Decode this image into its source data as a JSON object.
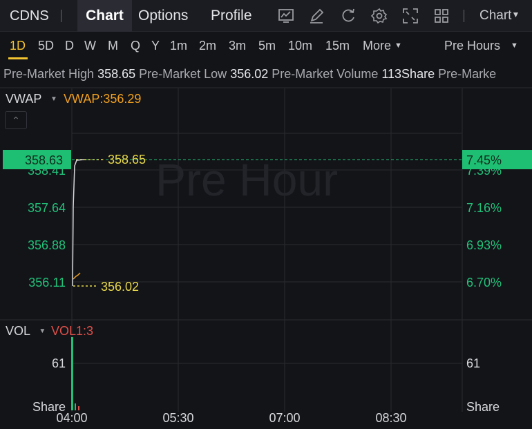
{
  "topbar": {
    "ticker": "CDNS",
    "tabs": [
      "Chart",
      "Options",
      "Profile"
    ],
    "active_tab": "Chart",
    "chart_menu": "Chart",
    "tools": [
      "chart-icon",
      "draw-pen-icon",
      "refresh-icon",
      "settings-gear-icon",
      "fullscreen-icon",
      "grid-layout-icon"
    ]
  },
  "timeframes": {
    "items": [
      "1D",
      "5D",
      "D",
      "W",
      "M",
      "Q",
      "Y",
      "1m",
      "2m",
      "3m",
      "5m",
      "10m",
      "15m",
      "More"
    ],
    "active": "1D",
    "session": "Pre Hours"
  },
  "info": {
    "high_label": "Pre-Market High",
    "high": "358.65",
    "low_label": "Pre-Market Low",
    "low": "356.02",
    "volume_label": "Pre-Market Volume",
    "volume": "113Share",
    "trailing": "Pre-Marke"
  },
  "indicators": {
    "main_name": "VWAP",
    "main_value": "VWAP:356.29",
    "sub_name": "VOL",
    "sub_value": "VOL1:3",
    "collapse_symbol": "⌃"
  },
  "watermark": "Pre Hour",
  "colors": {
    "up_green": "#22c079",
    "price_badge": "#1fbf73",
    "vwap_orange": "#f0a020",
    "label_yellow": "#e8d84a",
    "vol_red": "#e0504a"
  },
  "chart_data": {
    "type": "line",
    "price_axis_left": [
      "358.41",
      "357.64",
      "356.88",
      "356.11"
    ],
    "pct_axis_right": [
      "7.39%",
      "7.16%",
      "6.93%",
      "6.70%"
    ],
    "current_price": "358.63",
    "current_pct": "7.45%",
    "high_marker": "358.65",
    "low_marker": "356.02",
    "x_labels": [
      "04:00",
      "05:30",
      "07:00",
      "08:30"
    ],
    "price_series": [
      {
        "time": "04:00",
        "price": 356.02
      },
      {
        "time": "04:00",
        "price": 358.63
      }
    ],
    "vwap_series": [
      {
        "time": "04:00",
        "value": 356.02
      },
      {
        "time": "04:05",
        "value": 356.29
      }
    ],
    "volume": {
      "axis_labels": [
        "61",
        "Share"
      ],
      "bars": [
        {
          "time": "04:00",
          "value": 113
        }
      ]
    }
  }
}
